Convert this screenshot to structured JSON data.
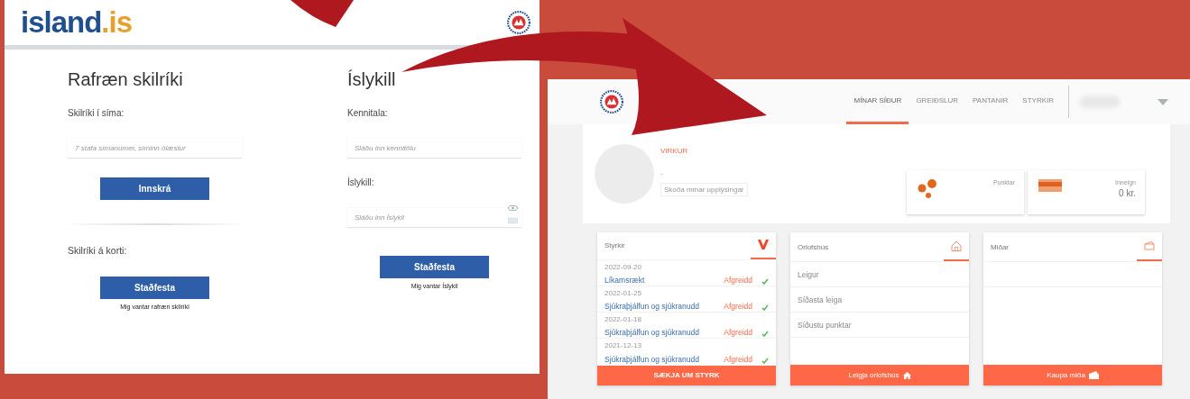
{
  "login_page": {
    "logo_text": "island",
    "logo_suffix": ".is",
    "electronic_id": {
      "title": "Rafræn skilríki",
      "phone_label": "Skilríki í síma:",
      "phone_placeholder": "7 stafa símanúmer, síminn ólæstur",
      "login_button": "Innskrá",
      "card_label": "Skilríki á korti:",
      "card_button": "Staðfesta",
      "help_link": "Mig vantar rafræn skilríki"
    },
    "islykill": {
      "title": "Íslykill",
      "id_label": "Kennitala:",
      "id_placeholder": "Sláðu inn kennitölu",
      "key_label": "Íslykill:",
      "key_placeholder": "Sláðu inn Íslykil",
      "confirm_button": "Staðfesta",
      "help_link": "Mig vantar Íslykil"
    }
  },
  "dashboard": {
    "nav": [
      {
        "label": "MÍNAR SÍÐUR",
        "selected": true
      },
      {
        "label": "GREIÐSLUR",
        "selected": false
      },
      {
        "label": "PANTANIR",
        "selected": false
      },
      {
        "label": "STYRKIR",
        "selected": false
      }
    ],
    "profile": {
      "status": "VIRKUR",
      "name": "-",
      "details_button": "Skoða mínar upplýsingar"
    },
    "stats": [
      {
        "kind": "points",
        "label": "Punktar"
      },
      {
        "kind": "balance",
        "label": "Inneign",
        "value": "0 kr."
      }
    ],
    "grants": {
      "title": "Styrkir",
      "items": [
        {
          "date": "2022-09-20",
          "name": "Líkamsrækt",
          "status": "Afgreidd"
        },
        {
          "date": "2022-01-25",
          "name": "Sjúkraþjálfun og sjúkranudd",
          "status": "Afgreidd"
        },
        {
          "date": "2022-01-18",
          "name": "Sjúkraþjálfun og sjúkranudd",
          "status": "Afgreidd"
        },
        {
          "date": "2021-12-13",
          "name": "Sjúkraþjálfun og sjúkranudd",
          "status": "Afgreidd"
        }
      ],
      "button": "SÆKJA UM STYRK"
    },
    "cottages": {
      "title": "Orlofshús",
      "items": [
        "Leigur",
        "Síðasta leiga",
        "Síðustu punktar"
      ],
      "button": "Leigja orlofshús"
    },
    "tickets": {
      "title": "Miðar",
      "button": "Kaupa miða"
    }
  }
}
